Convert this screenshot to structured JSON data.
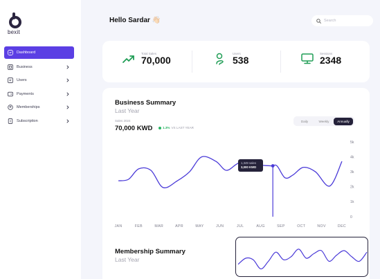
{
  "sidebar": {
    "logo_text": "bexit",
    "items": [
      {
        "label": "Dashboard",
        "icon": "dashboard-icon",
        "active": true
      },
      {
        "label": "Business",
        "icon": "business-icon"
      },
      {
        "label": "Users",
        "icon": "users-icon"
      },
      {
        "label": "Payments",
        "icon": "payments-icon"
      },
      {
        "label": "Memberships",
        "icon": "memberships-icon"
      },
      {
        "label": "Subscription",
        "icon": "subscription-icon"
      }
    ]
  },
  "header": {
    "greeting": "Hello Sardar 👋🏻",
    "search_placeholder": "Search"
  },
  "stats": [
    {
      "label": "Total Sales",
      "value": "70,000",
      "icon": "trend-up-icon"
    },
    {
      "label": "Users",
      "value": "538",
      "icon": "user-icon"
    },
    {
      "label": "Sessions",
      "value": "2348",
      "icon": "monitor-icon"
    }
  ],
  "business_summary": {
    "title": "Business Summary",
    "subtitle": "Last Year",
    "sales_label": "Sales 2024",
    "sales_value": "70,000 KWD",
    "growth_pct": "1.3%",
    "growth_text": "VS LAST YEAR",
    "tabs": [
      "Daily",
      "Weekly",
      "Annually"
    ],
    "active_tab": "Annually",
    "tooltip": {
      "line1": "1,349 sales",
      "line2": "3,000 KWD"
    }
  },
  "chart_data": {
    "type": "line",
    "categories": [
      "JAN",
      "FEB",
      "MAR",
      "APR",
      "MAY",
      "JUN",
      "JUL",
      "AUG",
      "SEP",
      "OCT",
      "NOV",
      "DEC"
    ],
    "x_positions": [
      0,
      0.5,
      1,
      1.5,
      2,
      2.5,
      3,
      3.5,
      4,
      4.5,
      5,
      5.5,
      6,
      6.5,
      7,
      7.5,
      8,
      8.5,
      9,
      9.5,
      10,
      10.5,
      11
    ],
    "values": [
      2500,
      3300,
      2000,
      2800,
      2400,
      4000,
      3300,
      3100,
      3700,
      3300,
      3400,
      3100,
      2800,
      3500,
      3000,
      2100,
      3600
    ],
    "series": [
      {
        "values": [
          [
            0,
            2400
          ],
          [
            0.5,
            2500
          ],
          [
            1,
            3200
          ],
          [
            1.6,
            3100
          ],
          [
            2.2,
            1950
          ],
          [
            2.9,
            2400
          ],
          [
            3.5,
            3000
          ],
          [
            4.1,
            4000
          ],
          [
            4.8,
            3700
          ],
          [
            5.3,
            3100
          ],
          [
            5.8,
            3500
          ],
          [
            6.2,
            3800
          ],
          [
            6.7,
            3500
          ],
          [
            7.5,
            3400
          ],
          [
            7.8,
            3400
          ],
          [
            8.2,
            2600
          ],
          [
            8.6,
            2800
          ],
          [
            9.1,
            3300
          ],
          [
            9.7,
            3000
          ],
          [
            10.4,
            2050
          ],
          [
            11,
            3700
          ]
        ]
      }
    ],
    "y_ticks": [
      "0",
      "1k",
      "2k",
      "3k",
      "4k",
      "5k"
    ],
    "ylim": [
      0,
      5000
    ],
    "highlight_index": "AUG",
    "highlight": {
      "x": 7.6,
      "y": 3400
    },
    "grid": "horizontal-none",
    "line_color": "#4a3ad8"
  },
  "membership_summary": {
    "title": "Membership Summary",
    "subtitle": "Last Year",
    "mini_chart": {
      "type": "line",
      "values": [
        0.7,
        0.5,
        0.55,
        0.85,
        0.6,
        0.3,
        0.55,
        0.45,
        0.2,
        0.5,
        0.35,
        0.25,
        0.6,
        0.4,
        0.25,
        0.45,
        0.6,
        0.3
      ]
    }
  },
  "colors": {
    "accent": "#5b3fe4",
    "dark": "#25223a",
    "green": "#28b463"
  }
}
